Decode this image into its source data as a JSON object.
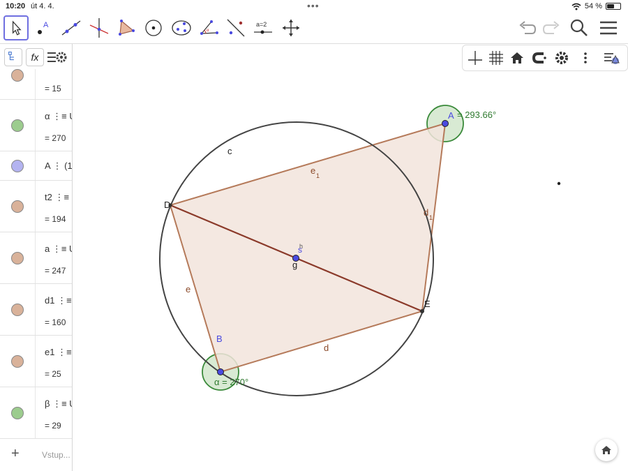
{
  "status": {
    "time": "10:20",
    "date": "út 4. 4.",
    "battery": "54 %",
    "battery_level": 0.54
  },
  "algebra": {
    "rows": [
      {
        "name": "",
        "value": "= 15",
        "color": "#d9b29a"
      },
      {
        "name": "α ⋮≡ U",
        "value": "= 270",
        "color": "#9ccc8e"
      },
      {
        "name": "A ⋮ (1",
        "value": "",
        "color": "#b3b3f0"
      },
      {
        "name": "t2 ⋮≡",
        "value": "= 194",
        "color": "#d9b29a"
      },
      {
        "name": "a ⋮≡ U",
        "value": "= 247",
        "color": "#d9b29a"
      },
      {
        "name": "d1 ⋮≡",
        "value": "= 160",
        "color": "#d9b29a"
      },
      {
        "name": "e1 ⋮≡",
        "value": "= 25",
        "color": "#d9b29a"
      },
      {
        "name": "β ⋮≡ U",
        "value": "= 29",
        "color": "#9ccc8e"
      }
    ],
    "input_placeholder": "Vstup...",
    "add_symbol": "+"
  },
  "canvas": {
    "labels": {
      "circle": "c",
      "e1": "e",
      "e1_sub": "1",
      "d1": "d",
      "d1_sub": "1",
      "e": "e",
      "d": "d",
      "g": "g",
      "s": "s",
      "h": "h",
      "D": "D",
      "E": "E",
      "B": "B",
      "A": "A",
      "angle_A": "= 293.66°",
      "angle_B": "α = 270°"
    },
    "colors": {
      "polygon_fill": "#f2e4dc",
      "polygon_stroke": "#b57a5a",
      "diag_stroke": "#8b3a2a",
      "circle_stroke": "#444444",
      "angle_fill": "#d8ead3",
      "angle_stroke": "#3a8a3a",
      "point_fill": "#4a4ae0"
    }
  }
}
